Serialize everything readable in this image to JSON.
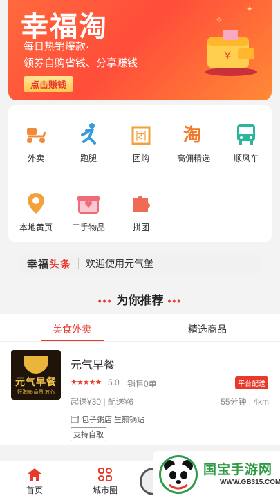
{
  "banner": {
    "title": "幸福淘",
    "subtitle1": "每日热销爆款·",
    "subtitle2": "领券自购省钱、分享赚钱",
    "cta_label": "点击赚钱"
  },
  "grid": [
    {
      "label": "外卖",
      "icon": "scooter-icon",
      "color": "#f28a3b"
    },
    {
      "label": "跑腿",
      "icon": "runner-icon",
      "color": "#3a9bdc"
    },
    {
      "label": "团购",
      "icon": "group-buy-icon",
      "color": "#f2a23b"
    },
    {
      "label": "高佣精选",
      "icon": "tao-icon",
      "color": "#f07a2a"
    },
    {
      "label": "顺风车",
      "icon": "bus-icon",
      "color": "#2bb59a"
    },
    {
      "label": "本地黄页",
      "icon": "location-pin-icon",
      "color": "#f2a23b"
    },
    {
      "label": "二手物品",
      "icon": "gift-box-icon",
      "color": "#f06b7a"
    },
    {
      "label": "拼团",
      "icon": "puzzle-icon",
      "color": "#f06b55"
    }
  ],
  "headline": {
    "brand_black": "幸福",
    "brand_red": "头条",
    "message": "欢迎使用元气堡"
  },
  "section": {
    "title": "为你推荐",
    "dots": "•••"
  },
  "tabs": [
    {
      "label": "美食外卖",
      "active": true
    },
    {
      "label": "精选商品",
      "active": false
    }
  ],
  "store": {
    "name": "元气早餐",
    "stars": "★★★★★",
    "rating": "5.0",
    "sales": "销售0单",
    "badge": "平台配送",
    "min_delivery": "起送¥30 | 配送¥6",
    "eta": "55分钟 | 4km",
    "categories": "包子粥店,生煎锅贴",
    "tag": "支持自取",
    "logo_text": "元气早餐",
    "logo_small": "好滋味·品质·放心"
  },
  "bottom_nav": [
    {
      "label": "首页",
      "icon": "home-icon",
      "active": true
    },
    {
      "label": "城市圈",
      "icon": "grid-circles-icon",
      "active": false
    }
  ],
  "watermark": {
    "site": "国宝手游网",
    "url": "WWW.GB315.COM"
  },
  "colors": {
    "accent": "#e8392b",
    "banner": "#ff5a3a"
  }
}
